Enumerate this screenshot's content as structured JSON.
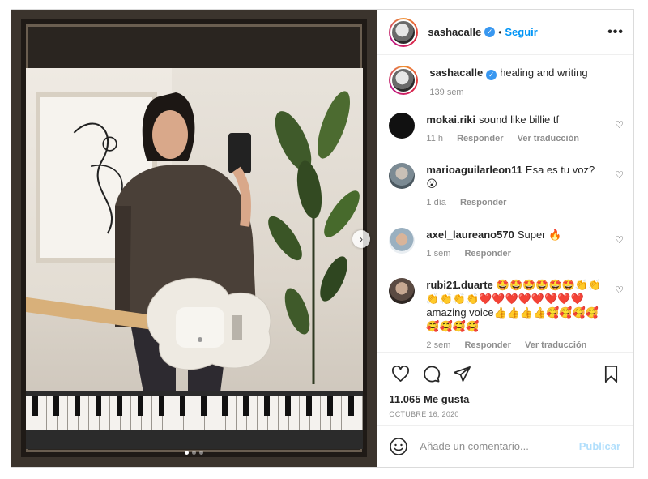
{
  "post": {
    "author": {
      "username": "sashacalle",
      "verified_icon": "verified-badge-icon",
      "follow_label": "Seguir",
      "separator": "•"
    },
    "media": {
      "carousel_count": 3,
      "carousel_active": 1
    },
    "caption": {
      "username": "sashacalle",
      "text": "healing and writing",
      "time": "139 sem"
    },
    "comments": [
      {
        "username": "mokai.riki",
        "text": "sound like billie tf",
        "time": "11 h",
        "reply_label": "Responder",
        "translate_label": "Ver traducción"
      },
      {
        "username": "marioaguilarleon11",
        "text": "Esa es tu voz? 😮",
        "time": "1 día",
        "reply_label": "Responder",
        "translate_label": ""
      },
      {
        "username": "axel_laureano570",
        "text": "Super 🔥",
        "time": "1 sem",
        "reply_label": "Responder",
        "translate_label": ""
      },
      {
        "username": "rubi21.duarte",
        "text": "🤩🤩🤩🤩🤩🤩👏👏👏👏👏👏❤️❤️❤️❤️❤️❤️❤️❤️amazing voice👍👍👍👍🥰🥰🥰🥰🥰🥰🥰🥰",
        "time": "2 sem",
        "reply_label": "Responder",
        "translate_label": "Ver traducción"
      }
    ],
    "likes": "11.065 Me gusta",
    "date": "OCTUBRE 16, 2020",
    "add_comment": {
      "placeholder": "Añade un comentario...",
      "publish_label": "Publicar"
    },
    "colors": {
      "link_blue": "#0095f6",
      "publish_disabled": "#b2dffc",
      "meta_gray": "#8e8e8e"
    }
  }
}
